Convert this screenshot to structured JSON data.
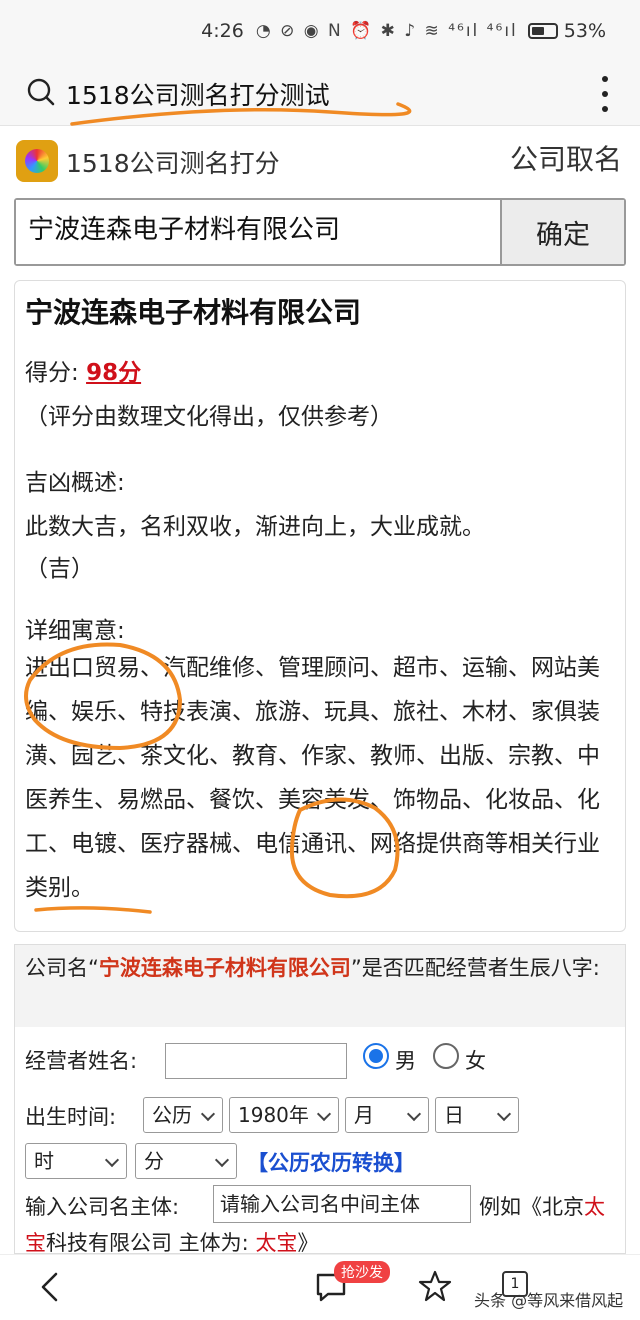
{
  "status": {
    "time": "4:26",
    "icons": "◔ ⊘ ◉ N ⏰ ✱ ♪ ≋ ⁴⁶ıl ⁴⁶ıl",
    "battery": "53%"
  },
  "search": {
    "query": "1518公司测名打分测试"
  },
  "site": {
    "title": "1518公司测名打分",
    "link": "公司取名"
  },
  "form": {
    "input_value": "宁波连森电子材料有限公司",
    "confirm": "确定"
  },
  "result": {
    "company": "宁波连森电子材料有限公司",
    "score_label": "得分:",
    "score": "98分",
    "note": "（评分由数理文化得出，仅供参考）",
    "fortune_label": "吉凶概述:",
    "fortune_text": "此数大吉，名利双收，渐进向上，大业成就。",
    "fortune_tag": "（吉）",
    "detail_label": "详细寓意:",
    "detail_text": "进出口贸易、汽配维修、管理顾问、超市、运输、网站美编、娱乐、特技表演、旅游、玩具、旅社、木材、家俱装潢、园艺、茶文化、教育、作家、教师、出版、宗教、中医养生、易燃品、餐饮、美容美发、饰物品、化妆品、化工、电镀、医疗器械、电信通讯、网络提供商等相关行业类别。"
  },
  "match": {
    "head_prefix": "公司名“",
    "head_company": "宁波连森电子材料有限公司",
    "head_suffix": "”是否匹配经营者生辰八字:",
    "name_label": "经营者姓名:",
    "male": "男",
    "female": "女",
    "birth_label": "出生时间:",
    "calendar": "公历",
    "year": "1980年",
    "month": "月",
    "day": "日",
    "hour": "时",
    "minute": "分",
    "convert": "【公历农历转换】",
    "subject_label": "输入公司名主体:",
    "subject_placeholder": "请输入公司名中间主体",
    "example_a": "例如《北京",
    "example_b": "太",
    "example_c": "宝",
    "example_d": "科技有限公司 主体为:",
    "example_e": "太宝",
    "example_f": "》"
  },
  "nav": {
    "badge": "抢沙发",
    "tabs": "1",
    "watermark": "头条 @等风来借风起"
  }
}
